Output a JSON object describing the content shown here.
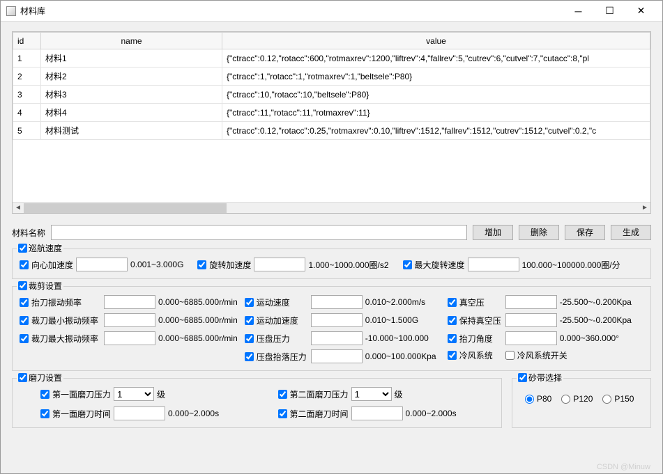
{
  "window": {
    "title": "材料库"
  },
  "table": {
    "headers": {
      "id": "id",
      "name": "name",
      "value": "value"
    },
    "rows": [
      {
        "id": "1",
        "name": "材料1",
        "value": "{\"ctracc\":0.12,\"rotacc\":600,\"rotmaxrev\":1200,\"liftrev\":4,\"fallrev\":5,\"cutrev\":6,\"cutvel\":7,\"cutacc\":8,\"pl"
      },
      {
        "id": "2",
        "name": "材料2",
        "value": "{\"ctracc\":1,\"rotacc\":1,\"rotmaxrev\":1,\"beltsele\":P80}"
      },
      {
        "id": "3",
        "name": "材料3",
        "value": "{\"ctracc\":10,\"rotacc\":10,\"beltsele\":P80}"
      },
      {
        "id": "4",
        "name": "材料4",
        "value": "{\"ctracc\":11,\"rotacc\":11,\"rotmaxrev\":11}"
      },
      {
        "id": "5",
        "name": "材料测试",
        "value": "{\"ctracc\":0.12,\"rotacc\":0.25,\"rotmaxrev\":0.10,\"liftrev\":1512,\"fallrev\":1512,\"cutrev\":1512,\"cutvel\":0.2,\"c"
      }
    ]
  },
  "name_row": {
    "label": "材料名称",
    "value": "",
    "btn_add": "增加",
    "btn_del": "删除",
    "btn_save": "保存",
    "btn_gen": "生成"
  },
  "g_cruise": {
    "title": "巡航速度",
    "concentric_acc": {
      "label": "向心加速度",
      "range": "0.001~3.000G"
    },
    "rot_acc": {
      "label": "旋转加速度",
      "range": "1.000~1000.000圈/s2"
    },
    "max_rot": {
      "label": "最大旋转速度",
      "range": "100.000~100000.000圈/分"
    }
  },
  "g_cut": {
    "title": "裁剪设置",
    "lift_freq": {
      "label": "抬刀振动频率",
      "range": "0.000~6885.000r/min"
    },
    "min_freq": {
      "label": "裁刀最小振动频率",
      "range": "0.000~6885.000r/min"
    },
    "max_freq": {
      "label": "裁刀最大振动频率",
      "range": "0.000~6885.000r/min"
    },
    "move_speed": {
      "label": "运动速度",
      "range": "0.010~2.000m/s"
    },
    "move_acc": {
      "label": "运动加速度",
      "range": "0.010~1.500G"
    },
    "platen_press": {
      "label": "压盘压力",
      "range": "-10.000~100.000"
    },
    "platen_lift_press": {
      "label": "压盘抬落压力",
      "range": "0.000~100.000Kpa"
    },
    "vacuum": {
      "label": "真空压",
      "range": "-25.500~-0.200Kpa"
    },
    "hold_vacuum": {
      "label": "保持真空压",
      "range": "-25.500~-0.200Kpa"
    },
    "lift_angle": {
      "label": "抬刀角度",
      "range": "0.000~360.000°"
    },
    "cold_air": {
      "label": "冷风系统"
    },
    "cold_air_switch": {
      "label": "冷风系统开关"
    }
  },
  "g_knife": {
    "title": "磨刀设置",
    "p1_press": {
      "label": "第一面磨刀压力",
      "sel": "1",
      "unit": "级"
    },
    "p2_press": {
      "label": "第二面磨刀压力",
      "sel": "1",
      "unit": "级"
    },
    "p1_time": {
      "label": "第一面磨刀时间",
      "range": "0.000~2.000s"
    },
    "p2_time": {
      "label": "第二面磨刀时间",
      "range": "0.000~2.000s"
    }
  },
  "g_belt": {
    "title": "砂带选择",
    "opts": {
      "p80": "P80",
      "p120": "P120",
      "p150": "P150"
    },
    "selected": "P80"
  },
  "watermark": "CSDN @Minuw"
}
